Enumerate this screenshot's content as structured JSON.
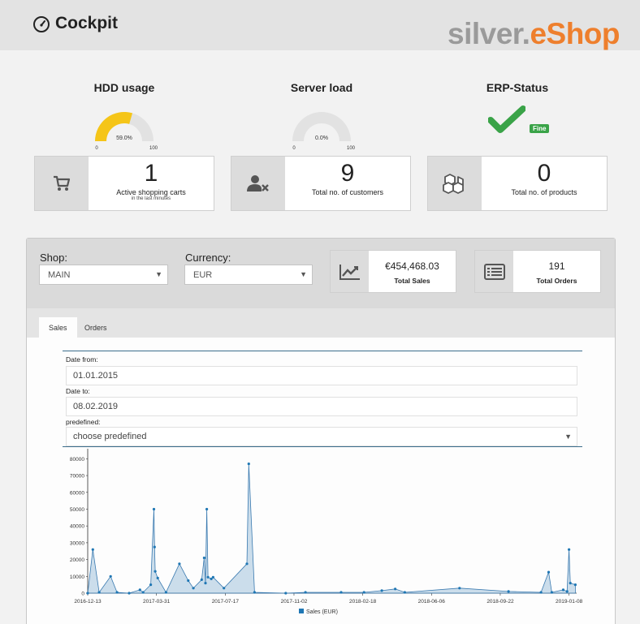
{
  "header": {
    "title": "Cockpit",
    "logo_silver": "silver.",
    "logo_eshop": "eShop",
    "icon": "speedometer-icon"
  },
  "gauges": {
    "hdd": {
      "title": "HDD usage",
      "value": 59.0,
      "value_label": "59.0%",
      "min": "0",
      "max": "100",
      "color": "#f5c518"
    },
    "server": {
      "title": "Server load",
      "value": 0.0,
      "value_label": "0.0%",
      "min": "0",
      "max": "100",
      "color": "#f5c518"
    },
    "erp": {
      "title": "ERP-Status",
      "status": "Fine",
      "icon": "checkmark-icon",
      "color": "#3aa348"
    }
  },
  "stats": {
    "carts": {
      "value": "1",
      "label": "Active shopping carts",
      "sub": "in the last minutes",
      "icon": "cart-icon"
    },
    "customers": {
      "value": "9",
      "label": "Total no. of customers",
      "icon": "user-remove-icon"
    },
    "products": {
      "value": "0",
      "label": "Total no. of products",
      "icon": "boxes-icon"
    }
  },
  "filters": {
    "shop_label": "Shop:",
    "shop_value": "MAIN",
    "currency_label": "Currency:",
    "currency_value": "EUR"
  },
  "kpis": {
    "sales": {
      "value": "€454,468.03",
      "label": "Total Sales",
      "icon": "trend-chart-icon"
    },
    "orders": {
      "value": "191",
      "label": "Total Orders",
      "icon": "list-icon"
    }
  },
  "tabs": [
    {
      "label": "Sales",
      "active": true
    },
    {
      "label": "Orders",
      "active": false
    }
  ],
  "form": {
    "date_from_label": "Date from:",
    "date_from_value": "01.01.2015",
    "date_to_label": "Date to:",
    "date_to_value": "08.02.2019",
    "predefined_label": "predefined:",
    "predefined_value": "choose predefined"
  },
  "chart_data": {
    "type": "area",
    "series": [
      {
        "name": "Sales (EUR)",
        "color": "#1f77b4"
      }
    ],
    "ylim": [
      0,
      85000
    ],
    "yticks": [
      0,
      10000,
      20000,
      30000,
      40000,
      50000,
      60000,
      70000,
      80000
    ],
    "xticks": [
      "2016-12-13",
      "2017-03-31",
      "2017-07-17",
      "2017-11-02",
      "2018-02-18",
      "2018-06-06",
      "2018-09-22",
      "2019-01-08"
    ],
    "points": [
      [
        "2016-12-13",
        0
      ],
      [
        "2016-12-21",
        26000
      ],
      [
        "2016-12-31",
        500
      ],
      [
        "2017-01-18",
        10000
      ],
      [
        "2017-01-28",
        500
      ],
      [
        "2017-02-16",
        0
      ],
      [
        "2017-03-05",
        2000
      ],
      [
        "2017-03-10",
        500
      ],
      [
        "2017-03-22",
        5000
      ],
      [
        "2017-03-27",
        50000
      ],
      [
        "2017-03-28",
        27500
      ],
      [
        "2017-03-29",
        13000
      ],
      [
        "2017-04-02",
        9000
      ],
      [
        "2017-04-15",
        500
      ],
      [
        "2017-05-06",
        17500
      ],
      [
        "2017-05-20",
        7500
      ],
      [
        "2017-05-28",
        3000
      ],
      [
        "2017-06-10",
        8000
      ],
      [
        "2017-06-14",
        21000
      ],
      [
        "2017-06-16",
        6000
      ],
      [
        "2017-06-18",
        50000
      ],
      [
        "2017-06-20",
        9500
      ],
      [
        "2017-06-25",
        8500
      ],
      [
        "2017-06-28",
        9500
      ],
      [
        "2017-07-15",
        3000
      ],
      [
        "2017-08-20",
        17500
      ],
      [
        "2017-08-23",
        77000
      ],
      [
        "2017-09-01",
        500
      ],
      [
        "2017-10-20",
        0
      ],
      [
        "2017-11-20",
        500
      ],
      [
        "2018-01-15",
        500
      ],
      [
        "2018-02-20",
        500
      ],
      [
        "2018-03-20",
        1500
      ],
      [
        "2018-04-10",
        2500
      ],
      [
        "2018-04-25",
        500
      ],
      [
        "2018-07-20",
        3000
      ],
      [
        "2018-10-05",
        1000
      ],
      [
        "2018-11-25",
        500
      ],
      [
        "2018-12-07",
        12500
      ],
      [
        "2018-12-12",
        500
      ],
      [
        "2018-12-30",
        2000
      ],
      [
        "2019-01-05",
        1000
      ],
      [
        "2019-01-08",
        26000
      ],
      [
        "2019-01-10",
        6000
      ],
      [
        "2019-01-18",
        5000
      ]
    ],
    "legend": "bottom"
  }
}
